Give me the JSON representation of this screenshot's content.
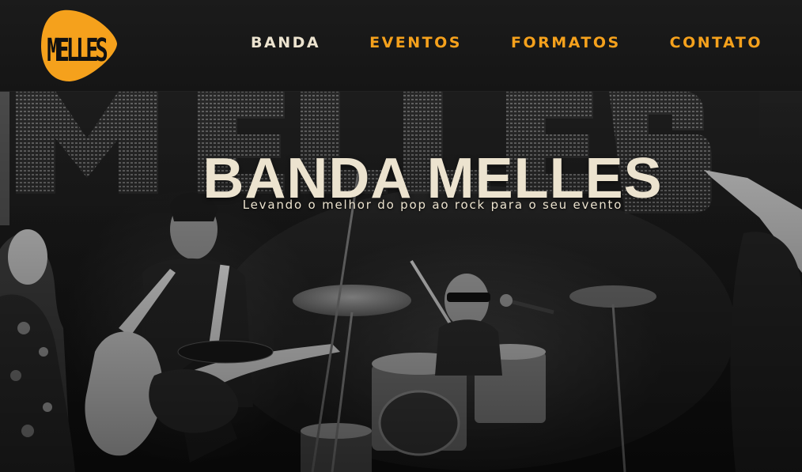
{
  "header": {
    "logo_text": "MELLES",
    "logo_color": "#f5a11c",
    "nav": [
      {
        "label": "BANDA",
        "active": true
      },
      {
        "label": "EVENTOS",
        "active": false
      },
      {
        "label": "FORMATOS",
        "active": false
      },
      {
        "label": "CONTATO",
        "active": false
      }
    ]
  },
  "hero": {
    "title": "BANDA MELLES",
    "subtitle": "Levando o melhor do pop ao rock para o seu evento",
    "background_text": "MELLES",
    "image_description_icon": "band-on-stage-photo"
  },
  "colors": {
    "accent": "#f5a11c",
    "cream": "#ece3cf",
    "header_bg": "#181818"
  }
}
